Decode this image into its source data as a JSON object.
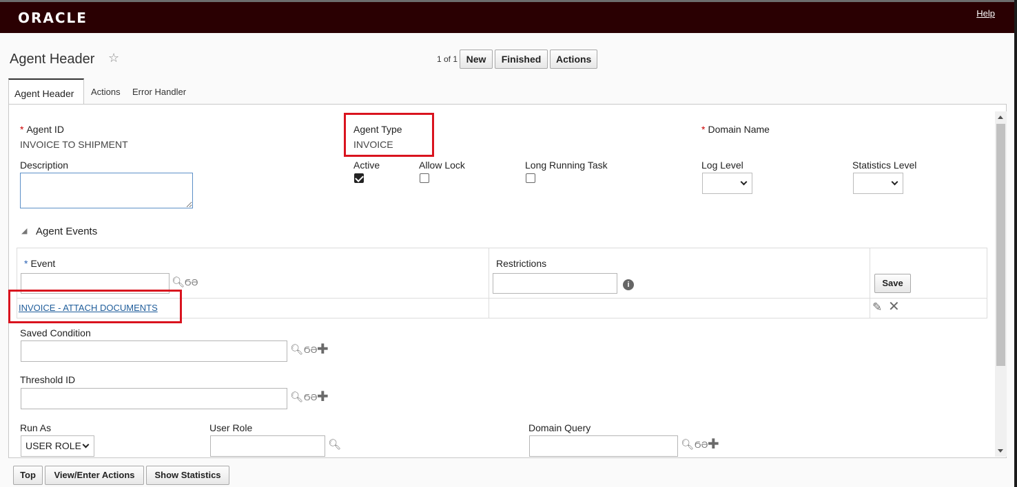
{
  "header": {
    "logo": "ORACLE",
    "help": "Help"
  },
  "page": {
    "title": "Agent Header",
    "pager": "1 of 1"
  },
  "toolbar": {
    "new_label": "New",
    "finished_label": "Finished",
    "actions_label": "Actions"
  },
  "tabs": [
    {
      "label": "Agent Header",
      "active": true
    },
    {
      "label": "Actions",
      "active": false
    },
    {
      "label": "Error Handler",
      "active": false
    }
  ],
  "form": {
    "agent_id": {
      "label": "Agent ID",
      "required": "*",
      "value": "INVOICE TO SHIPMENT"
    },
    "agent_type": {
      "label": "Agent Type",
      "value": "INVOICE"
    },
    "domain_name": {
      "label": "Domain Name",
      "required": "*"
    },
    "description": {
      "label": "Description",
      "value": ""
    },
    "active": {
      "label": "Active",
      "checked": true
    },
    "allow_lock": {
      "label": "Allow Lock",
      "checked": false
    },
    "long_running_task": {
      "label": "Long Running Task",
      "checked": false
    },
    "log_level": {
      "label": "Log Level",
      "value": ""
    },
    "statistics_level": {
      "label": "Statistics Level",
      "value": ""
    },
    "saved_condition": {
      "label": "Saved Condition"
    },
    "threshold_id": {
      "label": "Threshold ID"
    },
    "run_as": {
      "label": "Run As",
      "value": "USER ROLE"
    },
    "user_role": {
      "label": "User Role"
    },
    "domain_query": {
      "label": "Domain Query"
    }
  },
  "events": {
    "section_label": "Agent Events",
    "event_label": "Event",
    "event_required": "*",
    "restrictions_label": "Restrictions",
    "save_label": "Save",
    "rows": [
      {
        "event": "INVOICE - ATTACH DOCUMENTS",
        "restrictions": ""
      }
    ]
  },
  "bottom": {
    "top_label": "Top",
    "view_actions_label": "View/Enter Actions",
    "show_statistics_label": "Show Statistics"
  },
  "colors": {
    "topbar": "#2a0002",
    "highlight": "#d9131e",
    "link": "#1e5c9a",
    "required": "#cc0000"
  }
}
